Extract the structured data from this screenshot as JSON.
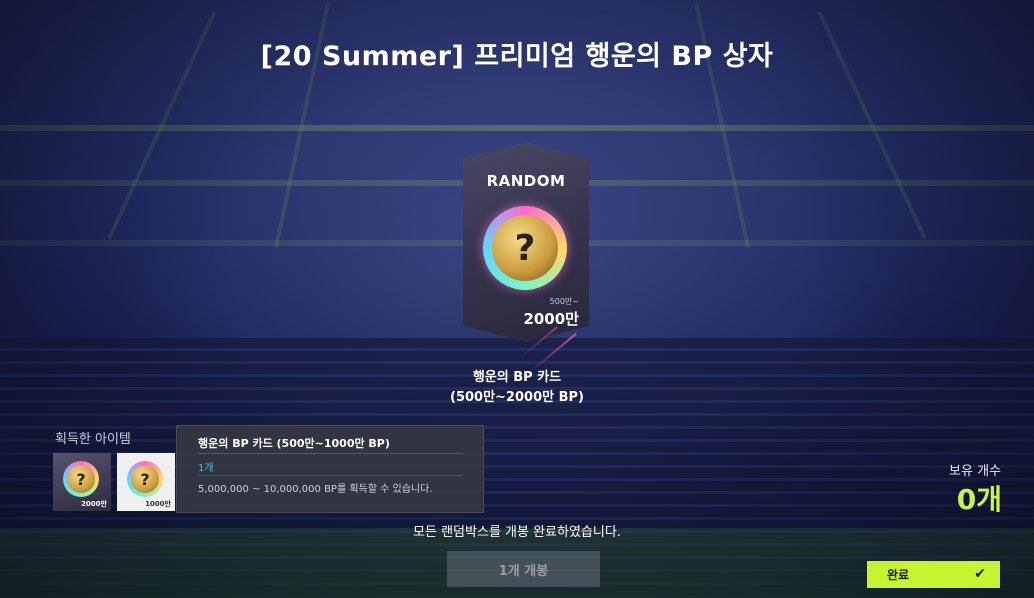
{
  "title": "[20 Summer] 프리미엄 행운의 BP 상자",
  "card": {
    "label": "RANDOM",
    "range_small": "500만~",
    "range_big": "2000만",
    "icon": "question-mark-coin"
  },
  "card_name": "행운의 BP 카드",
  "card_sub": "(500만~2000만 BP)",
  "acquired": {
    "label": "획득한 아이템",
    "items": [
      {
        "value": "2000만",
        "icon": "question-mark-coin"
      },
      {
        "value": "1000만",
        "icon": "question-mark-coin"
      }
    ]
  },
  "tooltip": {
    "title": "행운의 BP 카드 (500만~1000만 BP)",
    "count": "1개",
    "description": "5,000,000 ~ 10,000,000 BP를 획득할 수 있습니다."
  },
  "owned": {
    "label": "보유 개수",
    "count": "0개"
  },
  "done_message": "모든 랜덤박스를 개봉 완료하였습니다.",
  "open_button": "1개 개봉",
  "complete_button": "완료",
  "colors": {
    "accent": "#c7f431",
    "owned_count": "#c9f54a",
    "tooltip_count": "#4fb8e8"
  }
}
